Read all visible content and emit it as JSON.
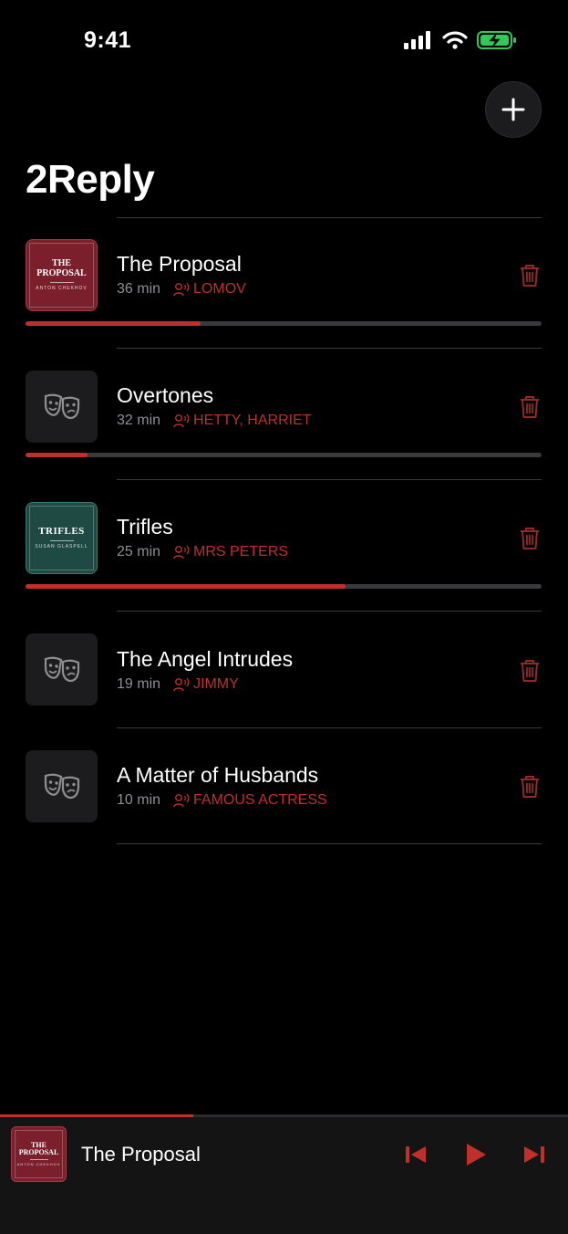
{
  "status_bar": {
    "time": "9:41"
  },
  "header": {
    "title": "2Reply"
  },
  "accent_color": "#c0302a",
  "items": [
    {
      "title": "The Proposal",
      "duration": "36 min",
      "role": "LOMOV",
      "thumbnail": "cover",
      "cover": {
        "title": "THE PROPOSAL",
        "author": "ANTON CHEKHOV"
      },
      "progress": 0.34
    },
    {
      "title": "Overtones",
      "duration": "32 min",
      "role": "HETTY, HARRIET",
      "thumbnail": "theater-masks-icon",
      "progress": 0.12
    },
    {
      "title": "Trifles",
      "duration": "25 min",
      "role": "MRS PETERS",
      "thumbnail": "cover",
      "cover": {
        "title": "TRIFLES",
        "author": "SUSAN GLASPELL"
      },
      "progress": 0.62
    },
    {
      "title": "The Angel Intrudes",
      "duration": "19 min",
      "role": "JIMMY",
      "thumbnail": "theater-masks-icon",
      "progress": null
    },
    {
      "title": "A Matter of Husbands",
      "duration": "10 min",
      "role": "FAMOUS ACTRESS",
      "thumbnail": "theater-masks-icon",
      "progress": null
    }
  ],
  "player": {
    "title": "The Proposal",
    "cover": {
      "title": "THE PROPOSAL",
      "author": "ANTON CHEKHOV"
    },
    "progress": 0.34
  }
}
